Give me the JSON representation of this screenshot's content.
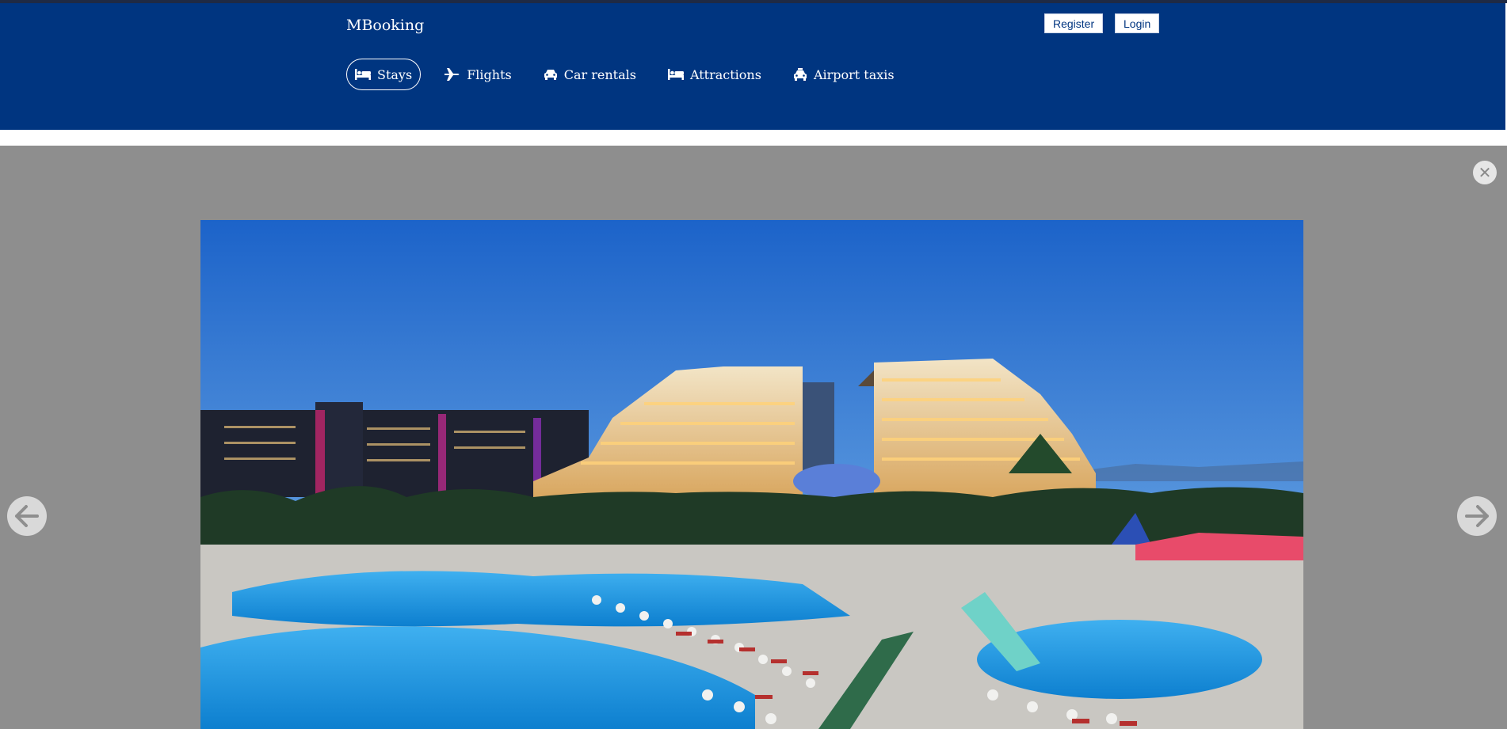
{
  "header": {
    "logo": "MBooking",
    "register_label": "Register",
    "login_label": "Login"
  },
  "nav": {
    "items": [
      {
        "label": "Stays",
        "icon": "bed-icon",
        "active": true
      },
      {
        "label": "Flights",
        "icon": "airplane-icon",
        "active": false
      },
      {
        "label": "Car rentals",
        "icon": "car-icon",
        "active": false
      },
      {
        "label": "Attractions",
        "icon": "bed-icon",
        "active": false
      },
      {
        "label": "Airport taxis",
        "icon": "taxi-icon",
        "active": false
      }
    ]
  },
  "lightbox": {
    "close_icon": "close-icon",
    "prev_icon": "arrow-left-icon",
    "next_icon": "arrow-right-icon",
    "photo": "hotel-resort-pool-night-photo"
  },
  "colors": {
    "brand": "#003580",
    "overlay": "#8e8e8e",
    "sky_top": "#2a6fd6",
    "pool": "#3fa9e8"
  }
}
